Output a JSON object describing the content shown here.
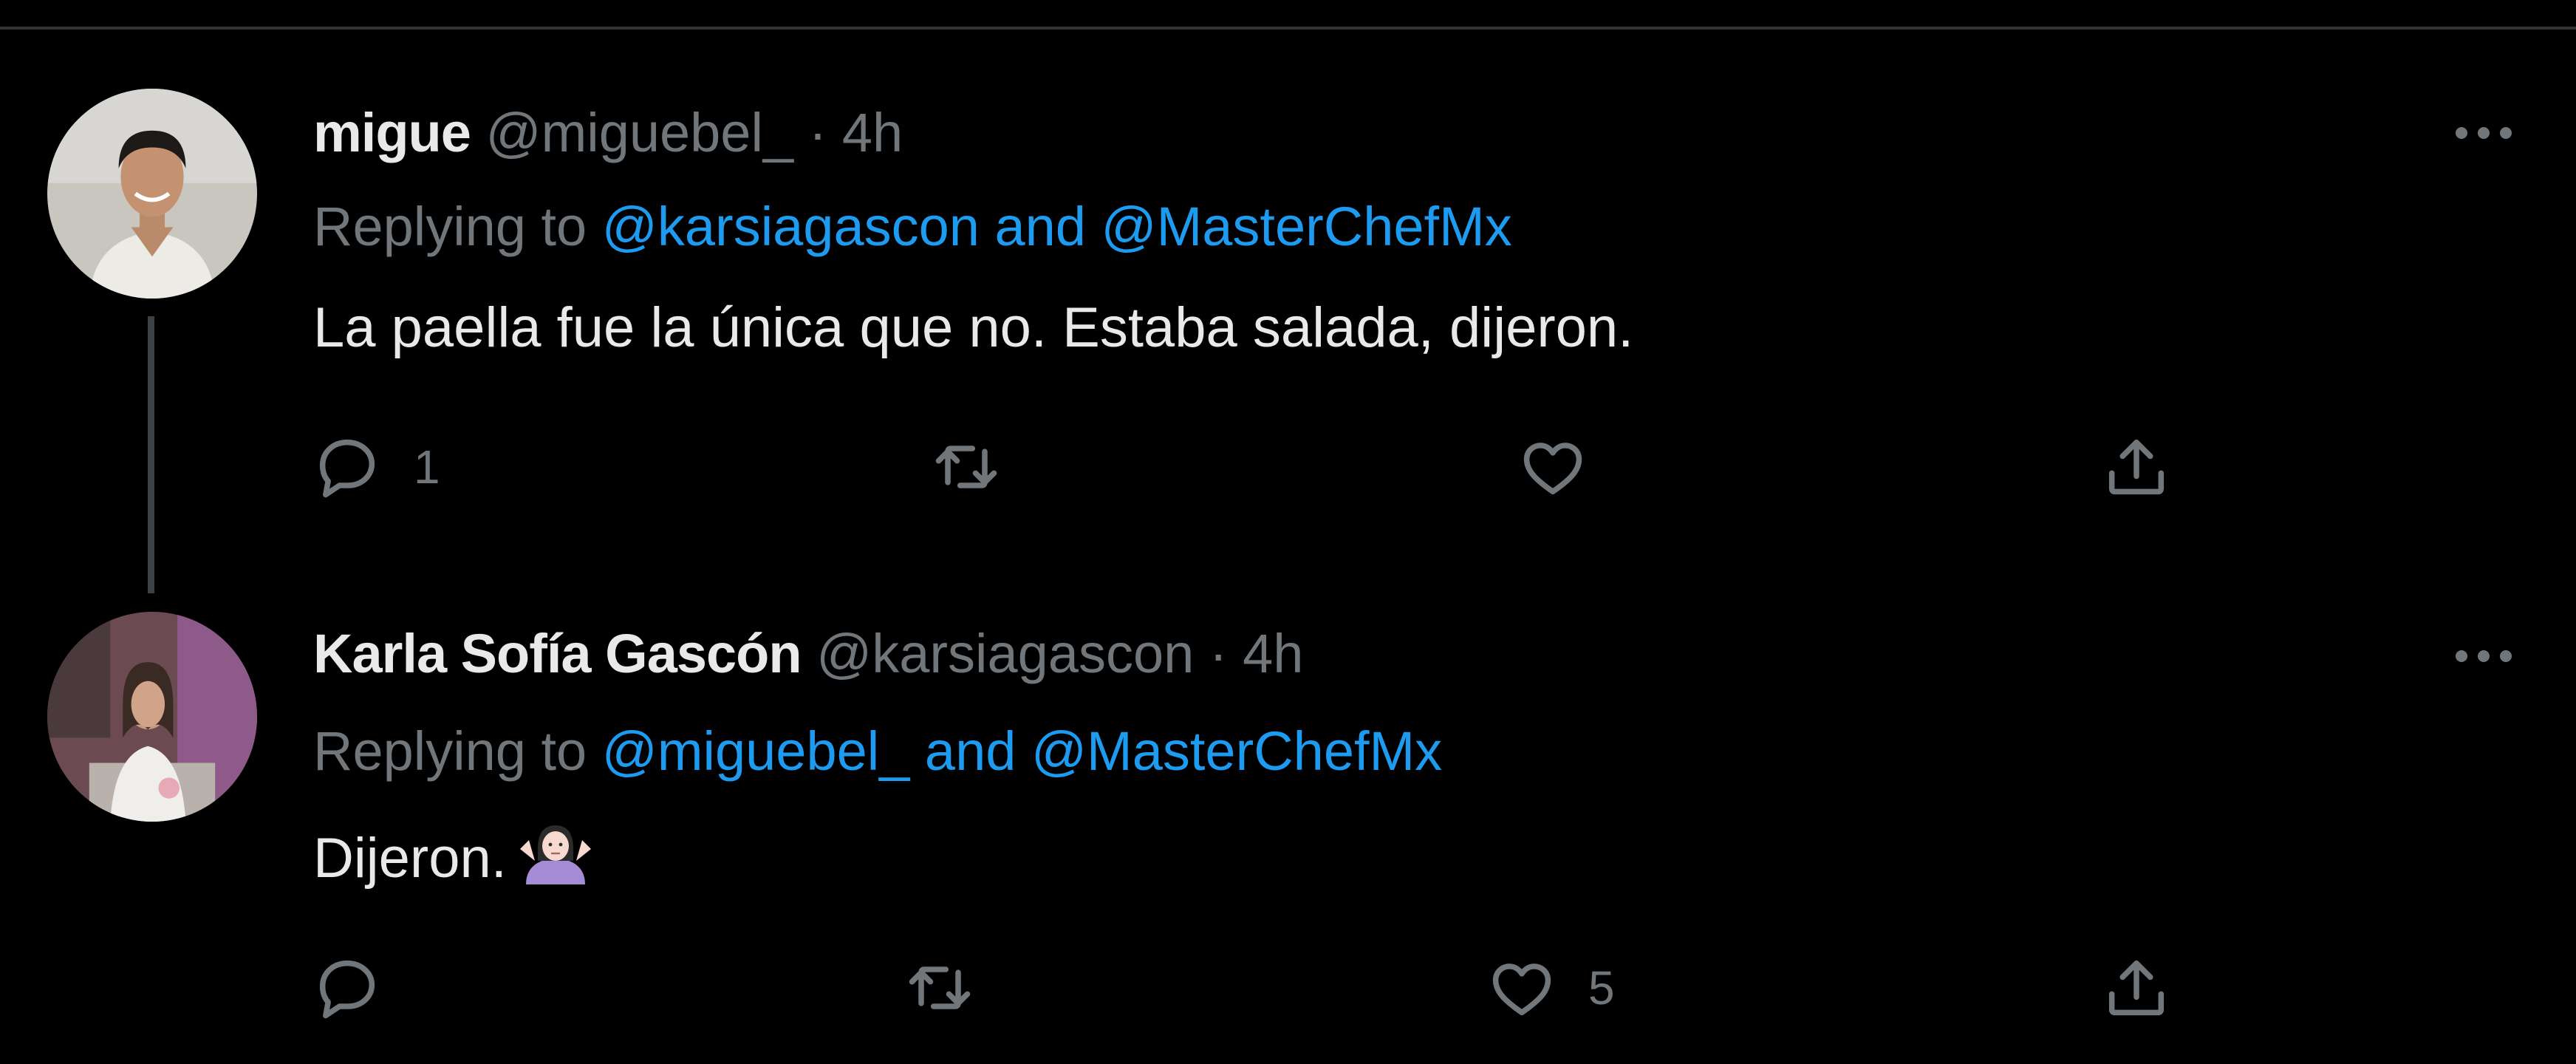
{
  "tweets": [
    {
      "name": "migue",
      "handle": "@miguebel_",
      "separator": "·",
      "time": "4h",
      "replying_prefix": "Replying to",
      "replying_to": "@karsiagascon and @MasterChefMx",
      "text": "La paella fue la única que no. Estaba salada, dijeron.",
      "reply_count": "1",
      "retweet_count": "",
      "like_count": "",
      "avatar_icon": "avatar-man"
    },
    {
      "name": "Karla Sofía Gascón",
      "handle": "@karsiagascon",
      "separator": "·",
      "time": "4h",
      "replying_prefix": "Replying to",
      "replying_to": "@miguebel_ and @MasterChefMx",
      "text": "Dijeron.",
      "emoji": "woman-shrugging-emoji",
      "reply_count": "",
      "retweet_count": "",
      "like_count": "5",
      "avatar_icon": "avatar-woman"
    }
  ],
  "colors": {
    "background": "#000000",
    "text_primary": "#e7e9ea",
    "text_secondary": "#71767b",
    "link": "#1d9bf0",
    "divider": "#2f3336"
  },
  "icons": [
    "reply-icon",
    "retweet-icon",
    "like-icon",
    "share-icon",
    "more-icon"
  ]
}
